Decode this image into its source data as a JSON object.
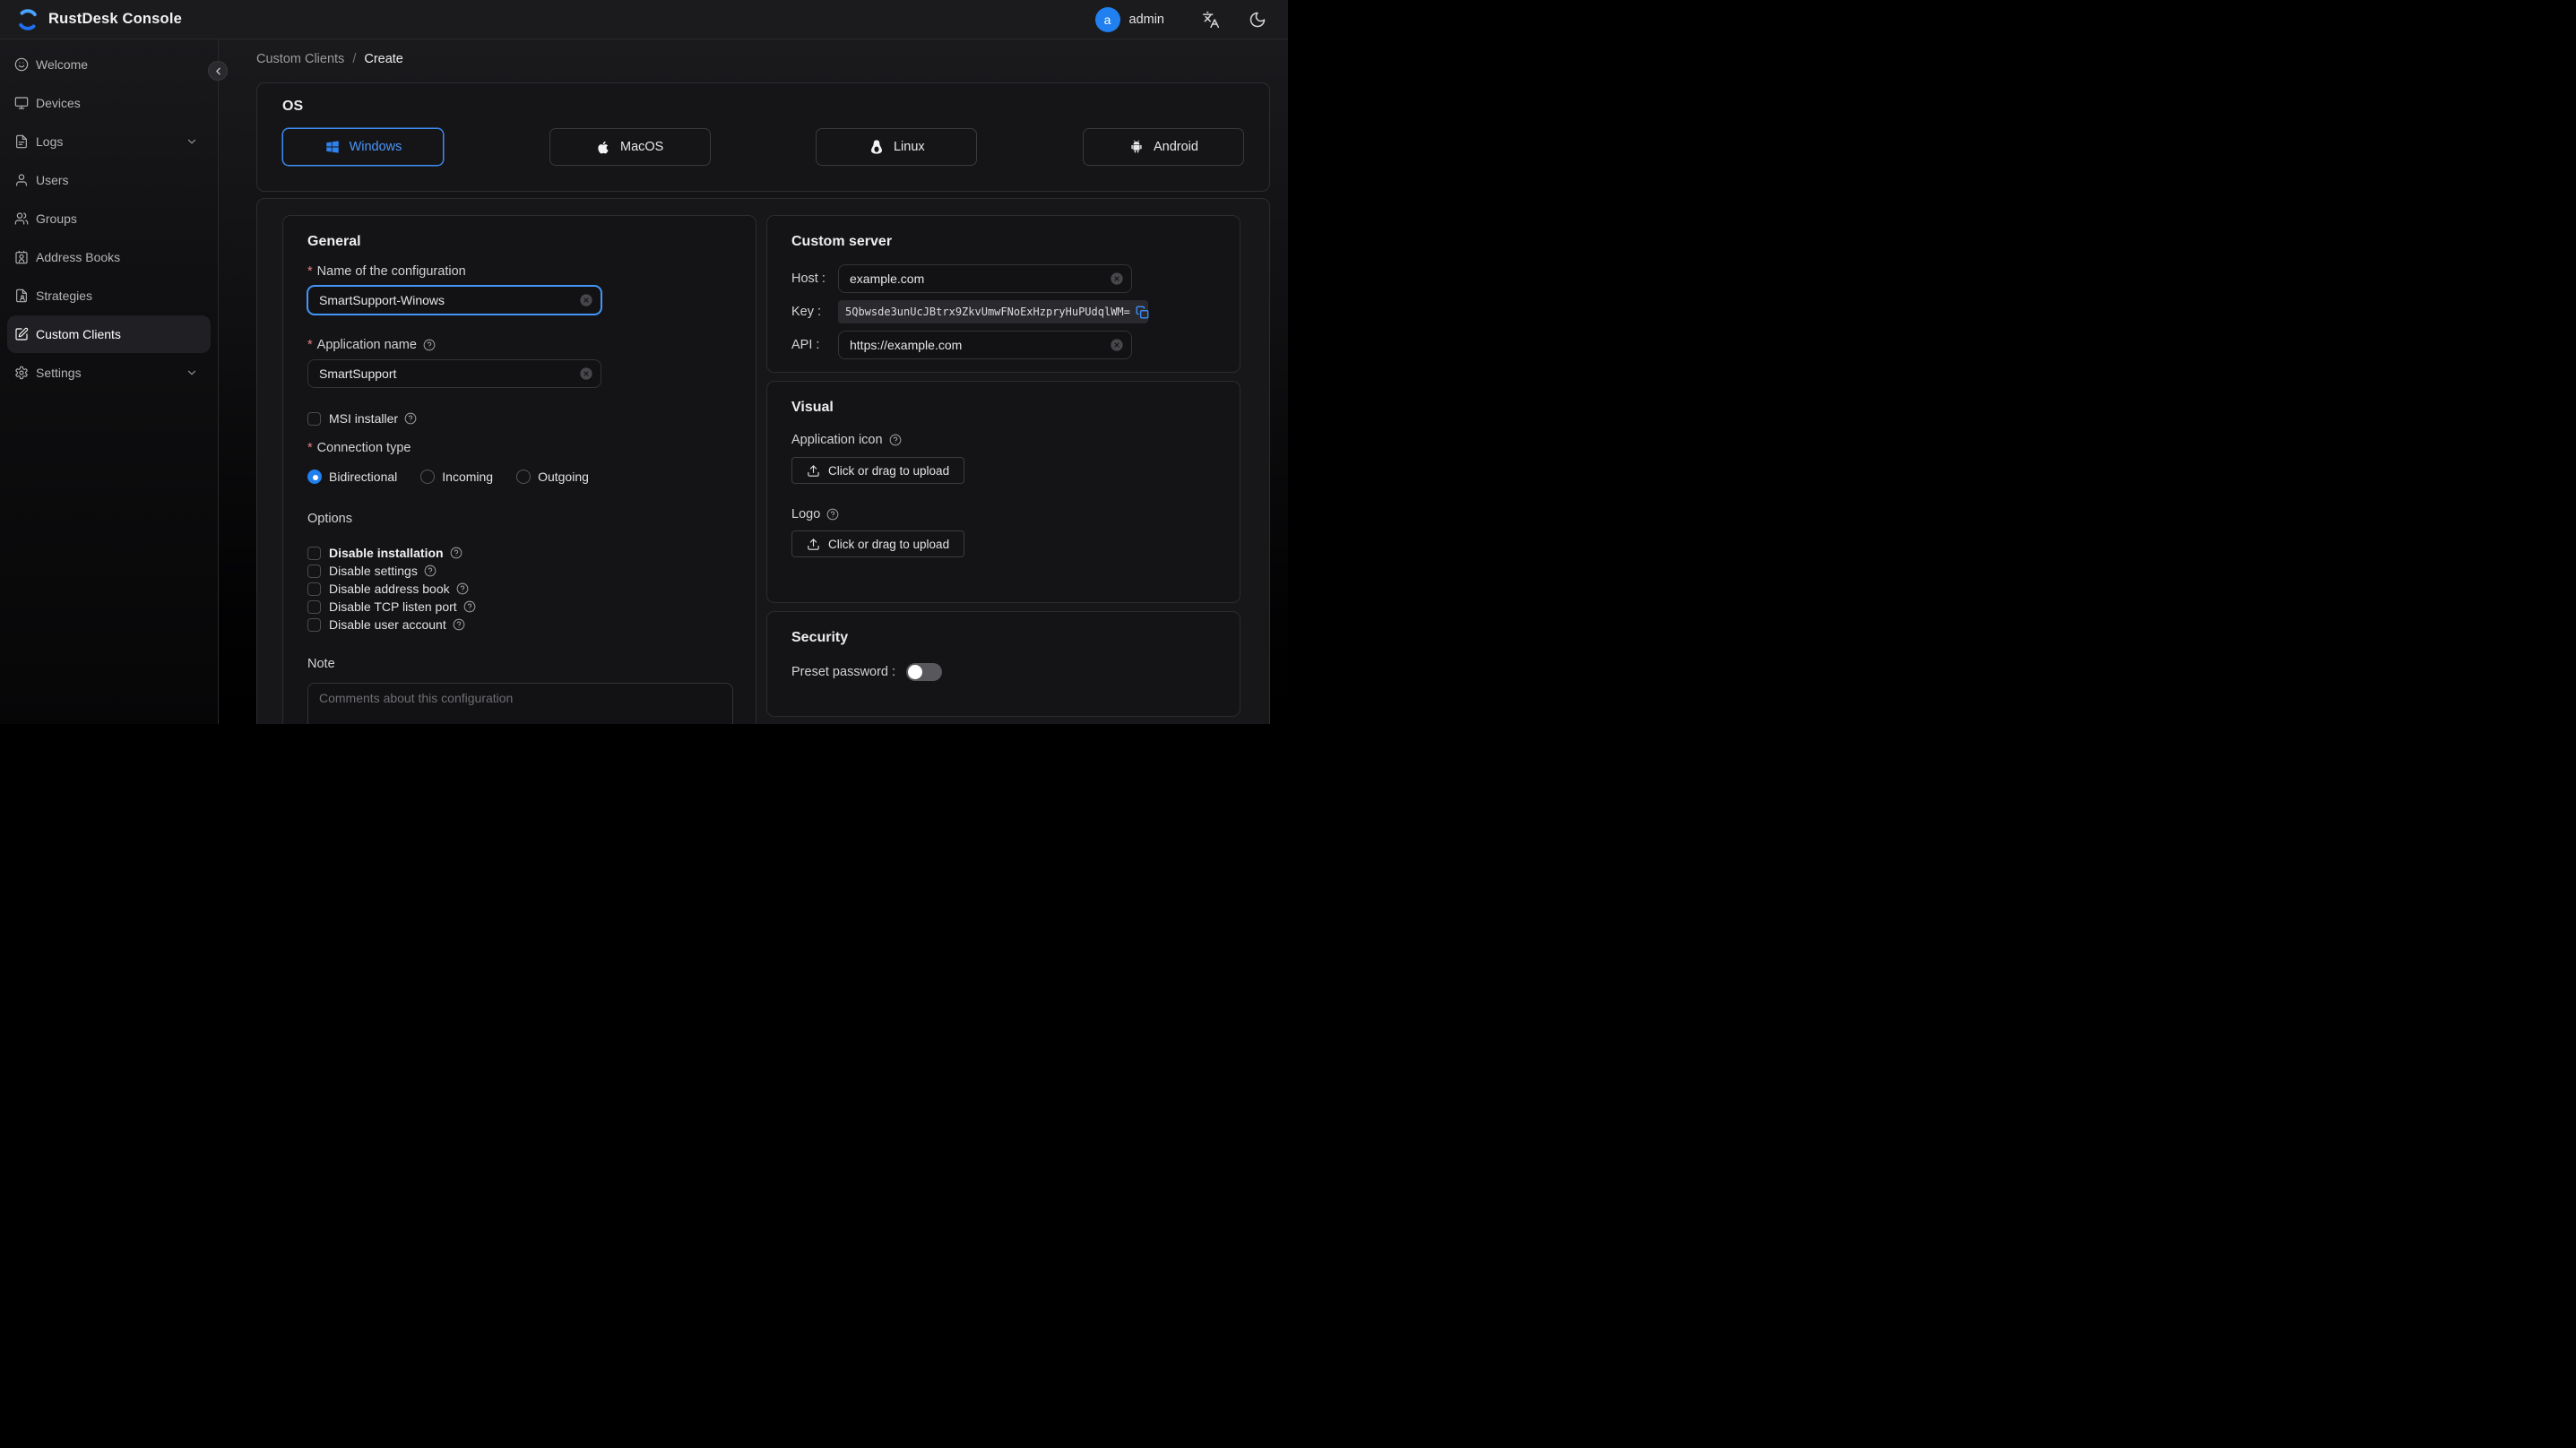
{
  "ui": {
    "required_marker": "*"
  },
  "header": {
    "title": "RustDesk Console",
    "user": {
      "initial": "a",
      "name": "admin"
    }
  },
  "sidebar": {
    "items": [
      {
        "label": "Welcome"
      },
      {
        "label": "Devices"
      },
      {
        "label": "Logs",
        "expandable": true
      },
      {
        "label": "Users"
      },
      {
        "label": "Groups"
      },
      {
        "label": "Address Books"
      },
      {
        "label": "Strategies"
      },
      {
        "label": "Custom Clients",
        "active": true
      },
      {
        "label": "Settings",
        "expandable": true
      }
    ]
  },
  "breadcrumb": {
    "parent": "Custom Clients",
    "separator": "/",
    "current": "Create"
  },
  "os": {
    "heading": "OS",
    "options": [
      {
        "label": "Windows",
        "selected": true
      },
      {
        "label": "MacOS",
        "selected": false
      },
      {
        "label": "Linux",
        "selected": false
      },
      {
        "label": "Android",
        "selected": false
      }
    ]
  },
  "general": {
    "heading": "General",
    "name_label": "Name of the configuration",
    "name_value": "SmartSupport-Winows",
    "app_name_label": "Application name",
    "app_name_value": "SmartSupport",
    "msi_label": "MSI installer",
    "connection_label": "Connection type",
    "connection_options": [
      {
        "label": "Bidirectional",
        "selected": true
      },
      {
        "label": "Incoming",
        "selected": false
      },
      {
        "label": "Outgoing",
        "selected": false
      }
    ],
    "options_heading": "Options",
    "options": [
      {
        "label": "Disable installation",
        "checked": false
      },
      {
        "label": "Disable settings",
        "checked": false
      },
      {
        "label": "Disable address book",
        "checked": false
      },
      {
        "label": "Disable TCP listen port",
        "checked": false
      },
      {
        "label": "Disable user account",
        "checked": false
      }
    ],
    "note_label": "Note",
    "note_placeholder": "Comments about this configuration"
  },
  "custom_server": {
    "heading": "Custom server",
    "host_label": "Host :",
    "host_value": "example.com",
    "key_label": "Key :",
    "key_value": "5Qbwsde3unUcJBtrx9ZkvUmwFNoExHzpryHuPUdqlWM=",
    "api_label": "API :",
    "api_value": "https://example.com"
  },
  "visual": {
    "heading": "Visual",
    "app_icon_label": "Application icon",
    "app_icon_upload_label": "Click or drag to upload",
    "logo_label": "Logo",
    "logo_upload_label": "Click or drag to upload"
  },
  "security": {
    "heading": "Security",
    "preset_password_label": "Preset password :",
    "preset_password_enabled": false
  },
  "colors": {
    "accent": "#3a8ef6",
    "primary": "#2080f0",
    "required": "#e88080"
  },
  "icons": {
    "logo": "rustdesk-swirl",
    "translate": "文A",
    "dark-mode": "☾",
    "sidebar": [
      "smile",
      "monitor",
      "file-text",
      "user",
      "users",
      "contact-card",
      "file-user",
      "square-pen",
      "gear"
    ],
    "os": [
      "windows-logo",
      "apple-logo",
      "tux-penguin",
      "android-robot"
    ],
    "misc": [
      "chevron-down",
      "chevron-left",
      "clear-circle-x",
      "help-circle",
      "copy",
      "upload"
    ]
  }
}
